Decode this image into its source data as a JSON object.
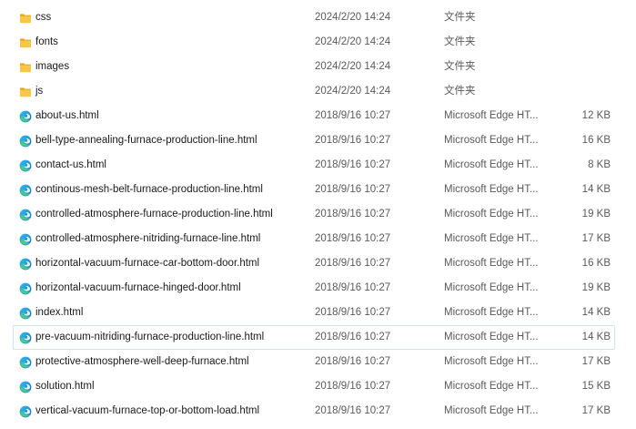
{
  "files": [
    {
      "name": "css",
      "date": "2024/2/20 14:24",
      "type": "文件夹",
      "size": "",
      "icon": "folder-icon"
    },
    {
      "name": "fonts",
      "date": "2024/2/20 14:24",
      "type": "文件夹",
      "size": "",
      "icon": "folder-icon"
    },
    {
      "name": "images",
      "date": "2024/2/20 14:24",
      "type": "文件夹",
      "size": "",
      "icon": "folder-icon"
    },
    {
      "name": "js",
      "date": "2024/2/20 14:24",
      "type": "文件夹",
      "size": "",
      "icon": "folder-icon"
    },
    {
      "name": "about-us.html",
      "date": "2018/9/16 10:27",
      "type": "Microsoft Edge HT...",
      "size": "12 KB",
      "icon": "edge-icon"
    },
    {
      "name": "bell-type-annealing-furnace-production-line.html",
      "date": "2018/9/16 10:27",
      "type": "Microsoft Edge HT...",
      "size": "16 KB",
      "icon": "edge-icon"
    },
    {
      "name": "contact-us.html",
      "date": "2018/9/16 10:27",
      "type": "Microsoft Edge HT...",
      "size": "8 KB",
      "icon": "edge-icon"
    },
    {
      "name": "continous-mesh-belt-furnace-production-line.html",
      "date": "2018/9/16 10:27",
      "type": "Microsoft Edge HT...",
      "size": "14 KB",
      "icon": "edge-icon"
    },
    {
      "name": "controlled-atmosphere-furnace-production-line.html",
      "date": "2018/9/16 10:27",
      "type": "Microsoft Edge HT...",
      "size": "19 KB",
      "icon": "edge-icon"
    },
    {
      "name": "controlled-atmosphere-nitriding-furnace-line.html",
      "date": "2018/9/16 10:27",
      "type": "Microsoft Edge HT...",
      "size": "17 KB",
      "icon": "edge-icon"
    },
    {
      "name": "horizontal-vacuum-furnace-car-bottom-door.html",
      "date": "2018/9/16 10:27",
      "type": "Microsoft Edge HT...",
      "size": "16 KB",
      "icon": "edge-icon"
    },
    {
      "name": "horizontal-vacuum-furnace-hinged-door.html",
      "date": "2018/9/16 10:27",
      "type": "Microsoft Edge HT...",
      "size": "19 KB",
      "icon": "edge-icon"
    },
    {
      "name": "index.html",
      "date": "2018/9/16 10:27",
      "type": "Microsoft Edge HT...",
      "size": "14 KB",
      "icon": "edge-icon"
    },
    {
      "name": "pre-vacuum-nitriding-furnace-production-line.html",
      "date": "2018/9/16 10:27",
      "type": "Microsoft Edge HT...",
      "size": "14 KB",
      "icon": "edge-icon",
      "hovered": true
    },
    {
      "name": "protective-atmosphere-well-deep-furnace.html",
      "date": "2018/9/16 10:27",
      "type": "Microsoft Edge HT...",
      "size": "17 KB",
      "icon": "edge-icon"
    },
    {
      "name": "solution.html",
      "date": "2018/9/16 10:27",
      "type": "Microsoft Edge HT...",
      "size": "15 KB",
      "icon": "edge-icon"
    },
    {
      "name": "vertical-vacuum-furnace-top-or-bottom-load.html",
      "date": "2018/9/16 10:27",
      "type": "Microsoft Edge HT...",
      "size": "17 KB",
      "icon": "edge-icon"
    }
  ]
}
